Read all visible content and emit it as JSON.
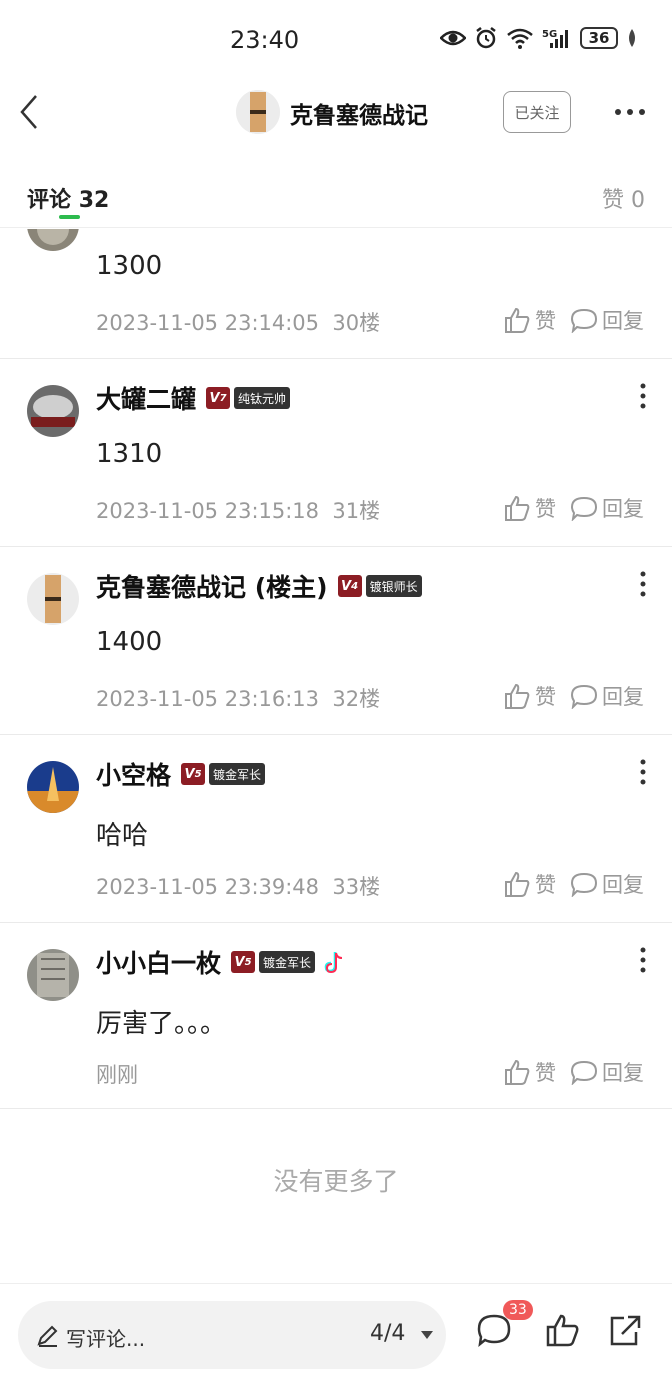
{
  "status_bar": {
    "time": "23:40",
    "battery": "36"
  },
  "header": {
    "title": "克鲁塞德战记",
    "follow_label": "已关注"
  },
  "tabs": {
    "comments_label": "评论",
    "comments_count": "32",
    "likes_label": "赞",
    "likes_count": "0"
  },
  "comments": [
    {
      "name": "",
      "text": "1300",
      "time": "2023-11-05 23:14:05",
      "floor": "30楼"
    },
    {
      "name": "大罐二罐",
      "level": "7",
      "title_badge": "纯钛元帅",
      "text": "1310",
      "time": "2023-11-05 23:15:18",
      "floor": "31楼"
    },
    {
      "name": "克鲁塞德战记 (楼主)",
      "level": "4",
      "title_badge": "镀银师长",
      "text": "1400",
      "time": "2023-11-05 23:16:13",
      "floor": "32楼"
    },
    {
      "name": "小空格",
      "level": "5",
      "title_badge": "镀金军长",
      "text": "哈哈",
      "time": "2023-11-05 23:39:48",
      "floor": "33楼"
    },
    {
      "name": "小小白一枚",
      "level": "5",
      "title_badge": "镀金军长",
      "text": "厉害了。。。",
      "time": "刚刚",
      "floor": ""
    }
  ],
  "actions": {
    "like_label": "赞",
    "reply_label": "回复"
  },
  "footer_text": "没有更多了",
  "bottom_bar": {
    "placeholder": "写评论...",
    "page": "4/4",
    "comment_badge": "33"
  },
  "colors": {
    "accent_green": "#2dbb4e",
    "badge_red": "#8c1d24",
    "notice_red": "#f05959"
  }
}
